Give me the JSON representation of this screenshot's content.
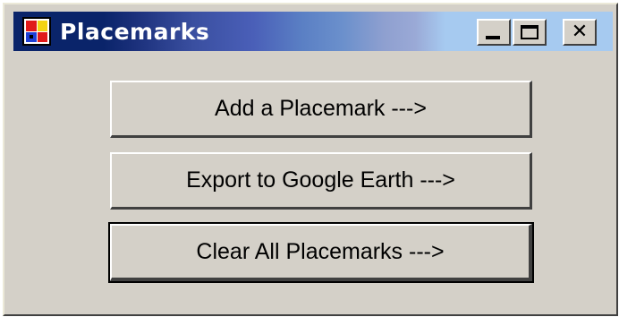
{
  "window": {
    "title": "Placemarks",
    "icon": "placemarks-app-icon",
    "controls": {
      "minimize": "minimize-icon",
      "maximize": "maximize-icon",
      "close_label": "✕"
    }
  },
  "buttons": {
    "add_label": "Add a Placemark --->",
    "export_label": "Export to Google Earth --->",
    "clear_label": "Clear All Placemarks --->"
  },
  "colors": {
    "titlebar_start": "#0a246a",
    "titlebar_end": "#a6caf0",
    "face": "#d4d0c8"
  }
}
